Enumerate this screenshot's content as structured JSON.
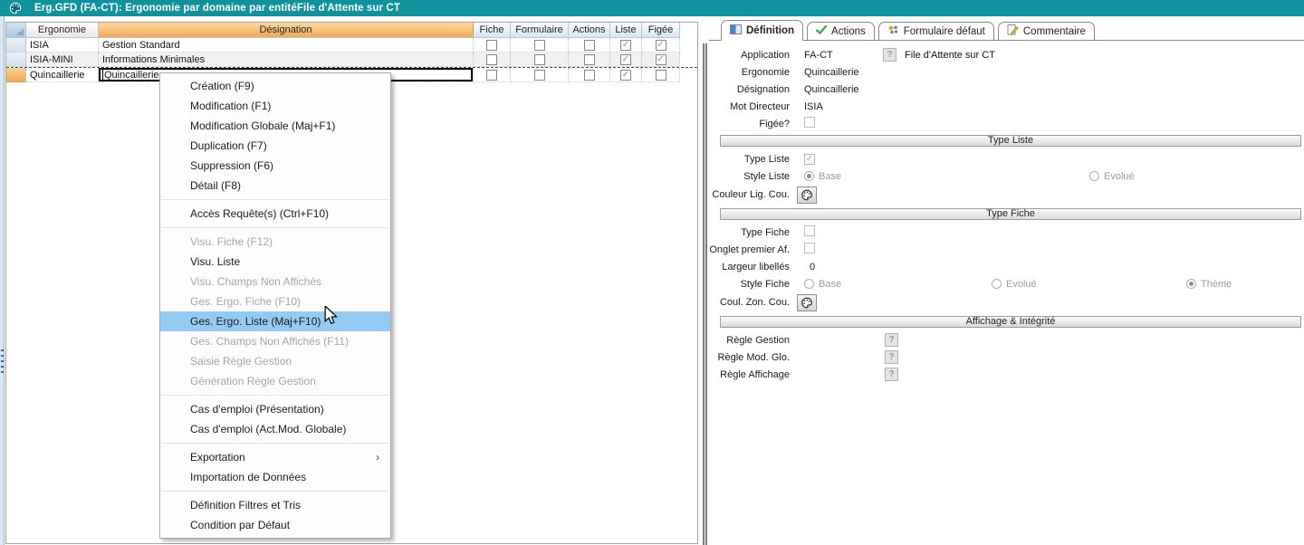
{
  "colors": {
    "titlebar_teal": "#10929E",
    "header_orange": "#F1AA54",
    "header_blue": "#D8E5F2",
    "selected_row_orange": "#EFAB52",
    "menu_highlight_blue": "#93CBF2",
    "disabled_text_gray": "#A5A5A5",
    "actions_check_green": "#3BA33B"
  },
  "window": {
    "title": "Erg.GFD (FA-CT): Ergonomie par domaine par entitéFile d'Attente sur CT"
  },
  "table": {
    "headers": {
      "ergonomie": "Ergonomie",
      "designation": "Désignation",
      "fiche": "Fiche",
      "formulaire": "Formulaire",
      "actions": "Actions",
      "liste": "Liste",
      "figee": "Figée"
    },
    "rows": [
      {
        "ergonomie": "ISIA",
        "designation": "Gestion Standard",
        "fiche": false,
        "formulaire": false,
        "actions": false,
        "liste": true,
        "figee": true,
        "selected": false,
        "editing": false
      },
      {
        "ergonomie": "ISIA-MINI",
        "designation": "Informations Minimales",
        "fiche": false,
        "formulaire": false,
        "actions": false,
        "liste": true,
        "figee": true,
        "selected": false,
        "editing": false
      },
      {
        "ergonomie": "Quincaillerie",
        "designation": "Quincaillerie",
        "fiche": false,
        "formulaire": false,
        "actions": false,
        "liste": true,
        "figee": false,
        "selected": true,
        "editing": true
      }
    ]
  },
  "context_menu": {
    "items": [
      {
        "label": "Création (F9)"
      },
      {
        "label": "Modification (F1)"
      },
      {
        "label": "Modification Globale (Maj+F1)"
      },
      {
        "label": "Duplication (F7)"
      },
      {
        "label": "Suppression (F6)"
      },
      {
        "label": "Détail (F8)"
      },
      {
        "separator": true
      },
      {
        "label": "Accès Requête(s) (Ctrl+F10)"
      },
      {
        "separator": true
      },
      {
        "label": "Visu. Fiche (F12)",
        "disabled": true
      },
      {
        "label": "Visu. Liste"
      },
      {
        "label": "Visu. Champs Non Affichés",
        "disabled": true
      },
      {
        "label": "Ges. Ergo. Fiche (F10)",
        "disabled": true
      },
      {
        "label": "Ges. Ergo. Liste (Maj+F10)",
        "highlighted": true
      },
      {
        "label": "Ges. Champs Non Affichés (F11)",
        "disabled": true
      },
      {
        "label": "Saisie Règle Gestion",
        "disabled": true
      },
      {
        "label": "Génération Règle Gestion",
        "disabled": true
      },
      {
        "separator": true
      },
      {
        "label": "Cas d'emploi (Présentation)"
      },
      {
        "label": "Cas d'emploi (Act.Mod. Globale)"
      },
      {
        "separator": true
      },
      {
        "label": "Exportation",
        "submenu": true
      },
      {
        "label": "Importation de Données"
      },
      {
        "separator": true
      },
      {
        "label": "Définition Filtres et Tris"
      },
      {
        "label": "Condition par Défaut"
      }
    ]
  },
  "panel": {
    "tabs": [
      {
        "label": "Définition",
        "active": true
      },
      {
        "label": "Actions",
        "active": false
      },
      {
        "label": "Formulaire défaut",
        "active": false
      },
      {
        "label": "Commentaire",
        "active": false
      }
    ],
    "identity": {
      "application_label": "Application",
      "application_value": "FA-CT",
      "application_help": "?",
      "application_desc": "File d'Attente sur CT",
      "ergonomie_label": "Ergonomie",
      "ergonomie_value": "Quincaillerie",
      "designation_label": "Désignation",
      "designation_value": "Quincaillerie",
      "mot_directeur_label": "Mot Directeur",
      "mot_directeur_value": "ISIA",
      "figee_label": "Figée?"
    },
    "type_liste": {
      "title": "Type Liste",
      "type_liste_label": "Type Liste",
      "style_liste_label": "Style Liste",
      "style_base": "Base",
      "style_evolue": "Evolué",
      "couleur_label": "Couleur Lig. Cou."
    },
    "type_fiche": {
      "title": "Type Fiche",
      "type_fiche_label": "Type Fiche",
      "onglet_label": "Onglet premier Af.",
      "largeur_label": "Largeur libellés",
      "largeur_value": "0",
      "style_fiche_label": "Style Fiche",
      "style_base": "Base",
      "style_evolue": "Evolué",
      "style_theme": "Thème",
      "coul_label": "Coul. Zon. Cou."
    },
    "affichage": {
      "title": "Affichage & Intégrité",
      "regle_gestion_label": "Règle Gestion",
      "regle_mod_label": "Règle Mod. Glo.",
      "regle_affichage_label": "Règle Affichage",
      "help": "?"
    }
  }
}
